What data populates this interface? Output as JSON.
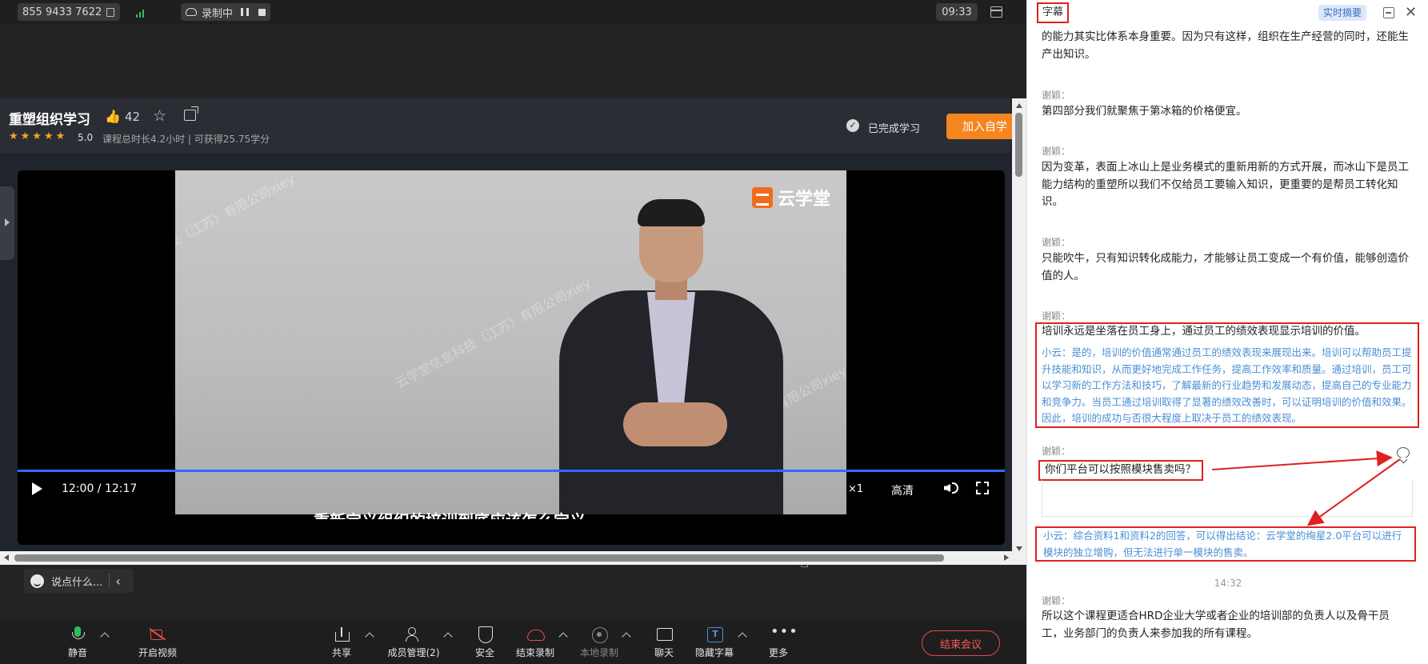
{
  "topbar": {
    "meeting_id": "855 9433 7622",
    "recording_label": "录制中",
    "clock": "09:33"
  },
  "course": {
    "title": "重塑组织学习",
    "likes": "42",
    "rating": "5.0",
    "meta": "课程总时长4.2小时 | 可获得25.75学分",
    "done_label": "已完成学习",
    "join_label": "加入自学"
  },
  "video": {
    "brand": "云学堂",
    "watermark": "云学堂信息科技（江苏）有限公司xiey",
    "subtitle": "重新定义组织的培训到底应该怎么定义",
    "time": "12:00 / 12:17",
    "speed": "×1",
    "quality": "高清",
    "progress": 0.98
  },
  "chat": {
    "placeholder": "说点什么..."
  },
  "toolbar": {
    "mute": "静音",
    "video": "开启视频",
    "share": "共享",
    "members": "成员管理(2)",
    "security": "安全",
    "end_record": "结束录制",
    "local_record": "本地录制",
    "chat": "聊天",
    "hide_caption": "隐藏字幕",
    "more": "更多",
    "end_meeting": "结束会议"
  },
  "panel": {
    "title": "字幕",
    "summary_btn": "实时摘要",
    "timestamp": "14:32",
    "entries": [
      {
        "speaker": "",
        "text": "的能力其实比体系本身重要。因为只有这样，组织在生产经营的同时，还能生产出知识。"
      },
      {
        "speaker": "谢颖：",
        "text": "第四部分我们就聚焦于第冰箱的价格便宜。"
      },
      {
        "speaker": "谢颖：",
        "text": "因为变革，表面上冰山上是业务模式的重新用新的方式开展，而冰山下是员工能力结构的重塑所以我们不仅给员工要输入知识，更重要的是帮员工转化知识。"
      },
      {
        "speaker": "谢颖：",
        "text": "只能吹牛，只有知识转化成能力，才能够让员工变成一个有价值，能够创造价值的人。"
      },
      {
        "speaker": "谢颖：",
        "text": "培训永远是坐落在员工身上，通过员工的绩效表现显示培训的价值。"
      },
      {
        "speaker": "谢颖：",
        "text": "你们平台可以按照模块售卖吗？"
      },
      {
        "speaker": "谢颖：",
        "text": "所以这个课程更适合HRD企业大学或者企业的培训部的负责人以及骨干员工，业务部门的负责人来参加我的所有课程。"
      }
    ],
    "ai_answer_1": "小云：是的，培训的价值通常通过员工的绩效表现来展现出来。培训可以帮助员工提升技能和知识，从而更好地完成工作任务，提高工作效率和质量。通过培训，员工可以学习新的工作方法和技巧，了解最新的行业趋势和发展动态，提高自己的专业能力和竞争力。当员工通过培训取得了显著的绩效改善时，可以证明培训的价值和效果。因此，培训的成功与否很大程度上取决于员工的绩效表现。",
    "ai_answer_2": "小云：综合资料1和资料2的回答，可以得出结论：云学堂的绚星2.0平台可以进行模块的独立增购，但无法进行单一模块的售卖。"
  },
  "colors": {
    "accent_orange": "#f5861f",
    "highlight_red": "#e02020",
    "ai_blue": "#4a8fd6",
    "progress_blue": "#2f6bff"
  }
}
